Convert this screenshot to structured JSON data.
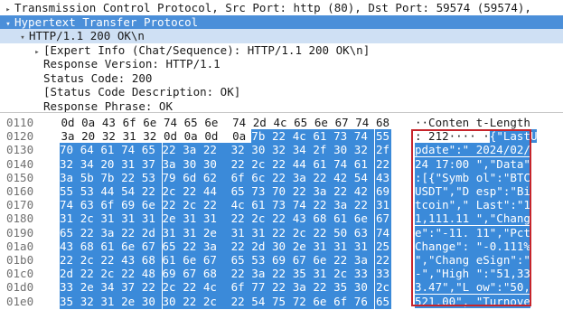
{
  "tree": [
    {
      "text": "Transmission Control Protocol, Src Port: http (80), Dst Port: 59574 (59574),",
      "indent": 0,
      "arrow": "▸",
      "state": "normal"
    },
    {
      "text": "Hypertext Transfer Protocol",
      "indent": 0,
      "arrow": "▾",
      "state": "selected"
    },
    {
      "text": "HTTP/1.1 200 OK\\n",
      "indent": 1,
      "arrow": "▾",
      "state": "selected-light"
    },
    {
      "text": "[Expert Info (Chat/Sequence): HTTP/1.1 200 OK\\n]",
      "indent": 2,
      "arrow": "▸",
      "state": "normal"
    },
    {
      "text": "Response Version: HTTP/1.1",
      "indent": 2,
      "arrow": "",
      "state": "normal"
    },
    {
      "text": "Status Code: 200",
      "indent": 2,
      "arrow": "",
      "state": "normal"
    },
    {
      "text": "[Status Code Description: OK]",
      "indent": 2,
      "arrow": "",
      "state": "normal"
    },
    {
      "text": "Response Phrase: OK",
      "indent": 2,
      "arrow": "",
      "state": "normal"
    }
  ],
  "hex_rows": [
    {
      "offset": "0110",
      "bytes": [
        "0d",
        "0a",
        "43",
        "6f",
        "6e",
        "74",
        "65",
        "6e",
        "74",
        "2d",
        "4c",
        "65",
        "6e",
        "67",
        "74",
        "68"
      ],
      "hl_start": 16,
      "ascii_plain": "··Conten t-Length",
      "ascii_hl": ""
    },
    {
      "offset": "0120",
      "bytes": [
        "3a",
        "20",
        "32",
        "31",
        "32",
        "0d",
        "0a",
        "0d",
        "0a",
        "7b",
        "22",
        "4c",
        "61",
        "73",
        "74",
        "55"
      ],
      "hl_start": 9,
      "ascii_plain": ": 212···· ·",
      "ascii_hl": "{\"LastU"
    },
    {
      "offset": "0130",
      "bytes": [
        "70",
        "64",
        "61",
        "74",
        "65",
        "22",
        "3a",
        "22",
        "32",
        "30",
        "32",
        "34",
        "2f",
        "30",
        "32",
        "2f"
      ],
      "hl_start": 0,
      "ascii_plain": "",
      "ascii_hl": "pdate\":\" 2024/02/"
    },
    {
      "offset": "0140",
      "bytes": [
        "32",
        "34",
        "20",
        "31",
        "37",
        "3a",
        "30",
        "30",
        "22",
        "2c",
        "22",
        "44",
        "61",
        "74",
        "61",
        "22"
      ],
      "hl_start": 0,
      "ascii_plain": "",
      "ascii_hl": "24 17:00 \",\"Data\""
    },
    {
      "offset": "0150",
      "bytes": [
        "3a",
        "5b",
        "7b",
        "22",
        "53",
        "79",
        "6d",
        "62",
        "6f",
        "6c",
        "22",
        "3a",
        "22",
        "42",
        "54",
        "43"
      ],
      "hl_start": 0,
      "ascii_plain": "",
      "ascii_hl": ":[{\"Symb ol\":\"BTC"
    },
    {
      "offset": "0160",
      "bytes": [
        "55",
        "53",
        "44",
        "54",
        "22",
        "2c",
        "22",
        "44",
        "65",
        "73",
        "70",
        "22",
        "3a",
        "22",
        "42",
        "69"
      ],
      "hl_start": 0,
      "ascii_plain": "",
      "ascii_hl": "USDT\",\"D esp\":\"Bi"
    },
    {
      "offset": "0170",
      "bytes": [
        "74",
        "63",
        "6f",
        "69",
        "6e",
        "22",
        "2c",
        "22",
        "4c",
        "61",
        "73",
        "74",
        "22",
        "3a",
        "22",
        "31"
      ],
      "hl_start": 0,
      "ascii_plain": "",
      "ascii_hl": "tcoin\",\" Last\":\"1"
    },
    {
      "offset": "0180",
      "bytes": [
        "31",
        "2c",
        "31",
        "31",
        "31",
        "2e",
        "31",
        "31",
        "22",
        "2c",
        "22",
        "43",
        "68",
        "61",
        "6e",
        "67"
      ],
      "hl_start": 0,
      "ascii_plain": "",
      "ascii_hl": "1,111.11 \",\"Chang"
    },
    {
      "offset": "0190",
      "bytes": [
        "65",
        "22",
        "3a",
        "22",
        "2d",
        "31",
        "31",
        "2e",
        "31",
        "31",
        "22",
        "2c",
        "22",
        "50",
        "63",
        "74"
      ],
      "hl_start": 0,
      "ascii_plain": "",
      "ascii_hl": "e\":\"-11. 11\",\"Pct"
    },
    {
      "offset": "01a0",
      "bytes": [
        "43",
        "68",
        "61",
        "6e",
        "67",
        "65",
        "22",
        "3a",
        "22",
        "2d",
        "30",
        "2e",
        "31",
        "31",
        "31",
        "25"
      ],
      "hl_start": 0,
      "ascii_plain": "",
      "ascii_hl": "Change\": \"-0.111%"
    },
    {
      "offset": "01b0",
      "bytes": [
        "22",
        "2c",
        "22",
        "43",
        "68",
        "61",
        "6e",
        "67",
        "65",
        "53",
        "69",
        "67",
        "6e",
        "22",
        "3a",
        "22"
      ],
      "hl_start": 0,
      "ascii_plain": "",
      "ascii_hl": "\",\"Chang eSign\":\""
    },
    {
      "offset": "01c0",
      "bytes": [
        "2d",
        "22",
        "2c",
        "22",
        "48",
        "69",
        "67",
        "68",
        "22",
        "3a",
        "22",
        "35",
        "31",
        "2c",
        "33",
        "33"
      ],
      "hl_start": 0,
      "ascii_plain": "",
      "ascii_hl": "-\",\"High \":\"51,33"
    },
    {
      "offset": "01d0",
      "bytes": [
        "33",
        "2e",
        "34",
        "37",
        "22",
        "2c",
        "22",
        "4c",
        "6f",
        "77",
        "22",
        "3a",
        "22",
        "35",
        "30",
        "2c"
      ],
      "hl_start": 0,
      "ascii_plain": "",
      "ascii_hl": "3.47\",\"L ow\":\"50,"
    },
    {
      "offset": "01e0",
      "bytes": [
        "35",
        "32",
        "31",
        "2e",
        "30",
        "30",
        "22",
        "2c",
        "22",
        "54",
        "75",
        "72",
        "6e",
        "6f",
        "76",
        "65"
      ],
      "hl_start": 0,
      "ascii_plain": "",
      "ascii_hl": "521.00\", \"Turnove"
    }
  ],
  "colors": {
    "selection": "#4b8fd9",
    "highlight": "#3b8ad9",
    "redbox": "#c6242b"
  }
}
